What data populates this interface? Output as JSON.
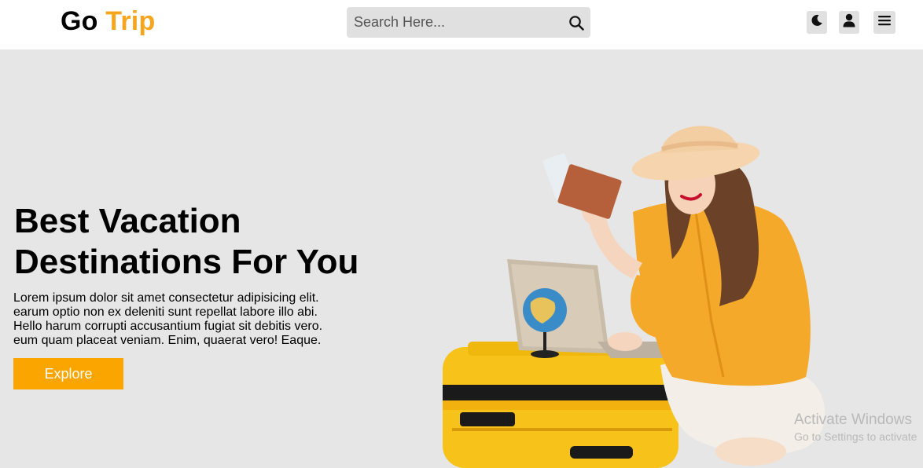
{
  "header": {
    "logo_part1": "Go",
    "logo_part2": "Trip",
    "search_placeholder": "Search Here..."
  },
  "icons": {
    "search": "search-icon",
    "theme": "moon-icon",
    "account": "user-icon",
    "menu": "menu-icon"
  },
  "hero": {
    "title_line1": "Best Vacation",
    "title_line2": "Destinations For You",
    "description": "Lorem ipsum dolor sit amet consectetur adipisicing elit. earum optio non ex deleniti sunt repellat labore illo abi. Hello harum corrupti accusantium fugiat sit debitis vero. eum quam placeat veniam. Enim, quaerat vero! Eaque.",
    "button_label": "Explore"
  },
  "watermark": {
    "line1": "Activate Windows",
    "line2": "Go to Settings to activate"
  },
  "colors": {
    "accent": "#fba500",
    "logo_accent": "#f7a51c",
    "background": "#e6e6e6",
    "header_bg": "#ffffff"
  }
}
